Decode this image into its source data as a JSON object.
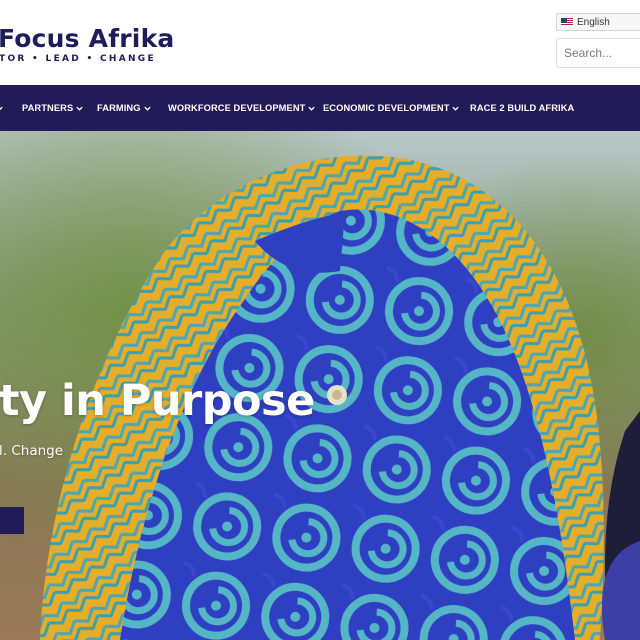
{
  "header": {
    "logo_title": "Focus Afrika",
    "logo_tagline": "TOR • LEAD • CHANGE",
    "language": "English",
    "search_placeholder": "Search..."
  },
  "nav": {
    "items": [
      {
        "label": "PARTNERS",
        "has_dropdown": true
      },
      {
        "label": "FARMING",
        "has_dropdown": true
      },
      {
        "label": "WORKFORCE DEVELOPMENT",
        "has_dropdown": true
      },
      {
        "label": "ECONOMIC DEVELOPMENT",
        "has_dropdown": true
      },
      {
        "label": "RACE 2 BUILD AFRIKA",
        "has_dropdown": false
      }
    ]
  },
  "hero": {
    "heading": "ty in Purpose",
    "subheading": "l. Change"
  },
  "colors": {
    "brand_navy": "#211c58",
    "scarf_blue": "#2e3fc4",
    "scarf_teal": "#4fb9c9",
    "scarf_yellow": "#e4ad2a"
  },
  "icons": [
    "flag-us-icon",
    "chevron-down-icon"
  ]
}
